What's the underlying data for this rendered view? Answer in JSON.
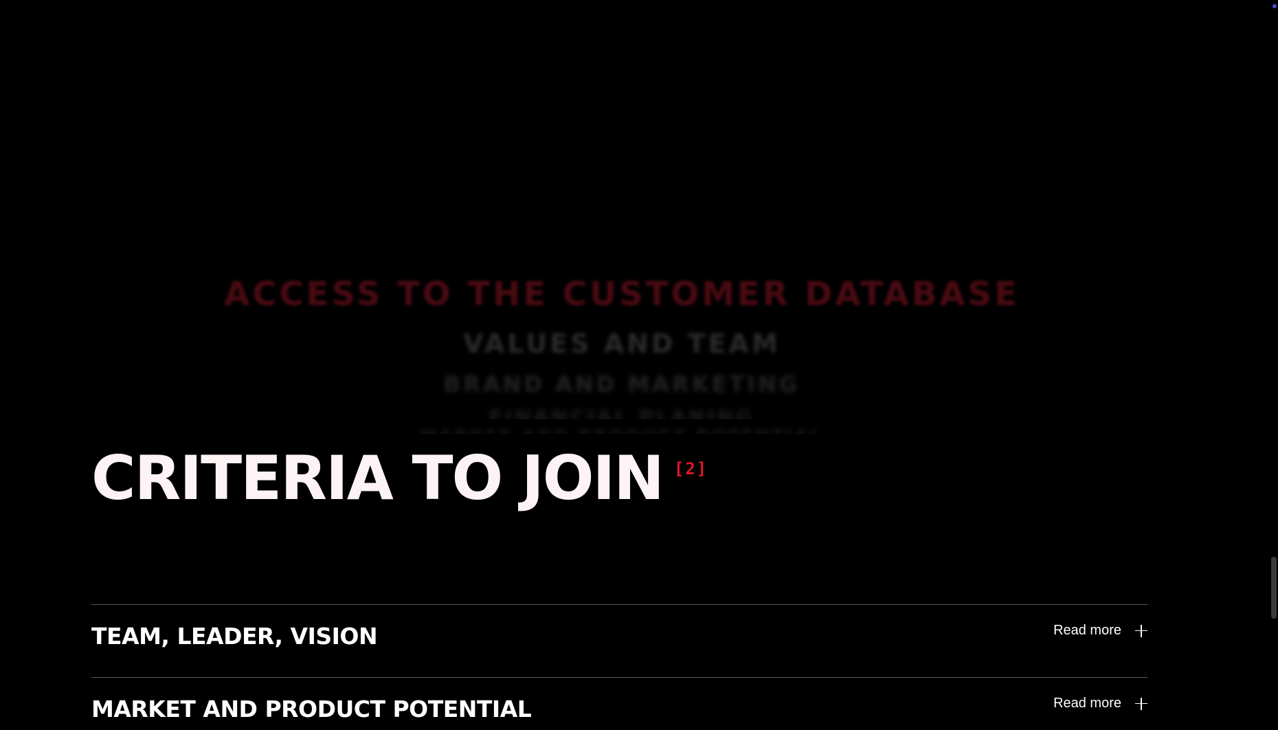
{
  "marquee": {
    "lines": [
      "ACCESS TO THE CUSTOMER DATABASE",
      "VALUES AND TEAM",
      "BRAND AND MARKETING",
      "FINANCIAL PLANING",
      "MARKET AND PRODUCT POTENTIAL"
    ]
  },
  "section": {
    "title": "CRITERIA TO JOIN",
    "badge": "[2]"
  },
  "criteria": {
    "items": [
      {
        "title": "TEAM, LEADER, VISION",
        "action": "Read more"
      },
      {
        "title": "MARKET AND PRODUCT POTENTIAL",
        "action": "Read more"
      }
    ]
  },
  "colors": {
    "background": "#000000",
    "accent": "#e0162b",
    "title": "#fdf3f5",
    "divider": "#5a5a5a"
  },
  "icons": [
    "plus-icon",
    "plus-icon"
  ]
}
